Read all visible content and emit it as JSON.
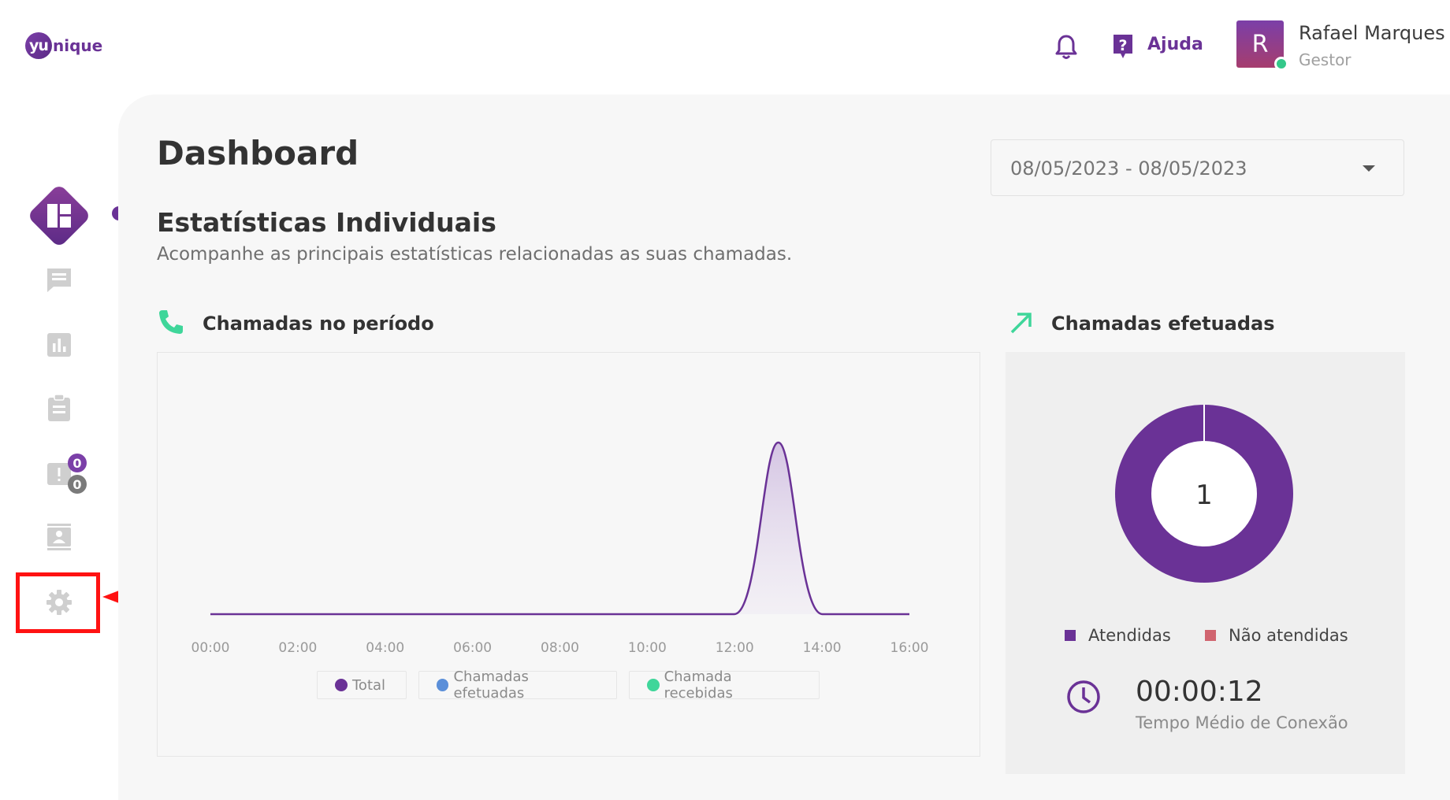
{
  "header": {
    "logo_badge": "yu",
    "logo_rest": "nique",
    "help_label": "Ajuda",
    "avatar_initial": "R",
    "user_name": "Rafael Marques",
    "user_role": "Gestor"
  },
  "sidebar": {
    "items": [
      {
        "name": "dashboard",
        "icon": "dashboard-icon",
        "active": true
      },
      {
        "name": "chat",
        "icon": "chat-icon"
      },
      {
        "name": "reports",
        "icon": "bar-chart-icon"
      },
      {
        "name": "clipboard",
        "icon": "clipboard-icon"
      },
      {
        "name": "alerts",
        "icon": "alert-icon",
        "badge_top": "0",
        "badge_bottom": "0"
      },
      {
        "name": "contacts",
        "icon": "contact-card-icon"
      },
      {
        "name": "settings",
        "icon": "gear-icon",
        "highlighted": true
      }
    ]
  },
  "main": {
    "page_title": "Dashboard",
    "date_range": "08/05/2023 - 08/05/2023",
    "section_title": "Estatísticas Individuais",
    "section_subtitle": "Acompanhe as principais estatísticas relacionadas as suas chamadas.",
    "line_card_title": "Chamadas no período",
    "donut_card_title": "Chamadas efetuadas",
    "donut_center": "1",
    "time_value": "00:00:12",
    "time_label": "Tempo Médio de Conexão"
  },
  "chart_data": [
    {
      "type": "line",
      "title": "Chamadas no período",
      "x": [
        "00:00",
        "02:00",
        "04:00",
        "06:00",
        "08:00",
        "10:00",
        "12:00",
        "14:00",
        "16:00"
      ],
      "series": [
        {
          "name": "Total",
          "color": "#6a3296",
          "values": [
            0,
            0,
            0,
            0,
            0,
            0,
            0,
            0,
            0
          ],
          "peak": {
            "x": "13:00",
            "y": 1
          }
        },
        {
          "name": "Chamadas efetuadas",
          "color": "#5b8fd9",
          "values": []
        },
        {
          "name": "Chamada recebidas",
          "color": "#3fd69a",
          "values": []
        }
      ]
    },
    {
      "type": "pie",
      "title": "Chamadas efetuadas",
      "categories": [
        "Atendidas",
        "Não atendidas"
      ],
      "values": [
        1,
        0
      ],
      "colors": [
        "#6a3296",
        "#d0646f"
      ]
    }
  ],
  "colors": {
    "brand": "#6a3296",
    "accent_green": "#34c88a",
    "highlight_red": "#ff1212"
  }
}
